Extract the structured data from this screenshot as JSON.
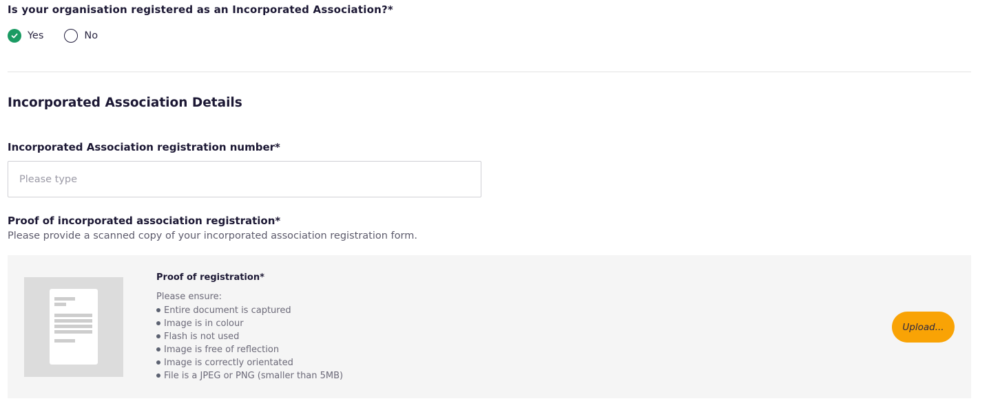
{
  "question": {
    "label": "Is your organisation registered as an Incorporated Association?*",
    "options": [
      {
        "label": "Yes",
        "selected": true
      },
      {
        "label": "No",
        "selected": false
      }
    ]
  },
  "section": {
    "title": "Incorporated Association Details"
  },
  "registration_number": {
    "label": "Incorporated Association registration number*",
    "placeholder": "Please type",
    "value": ""
  },
  "proof": {
    "label": "Proof of incorporated association registration*",
    "description": "Please provide a scanned copy of your incorporated association registration form.",
    "upload": {
      "title": "Proof of registration*",
      "ensure_title": "Please ensure:",
      "requirements": [
        "Entire document is captured",
        "Image is in colour",
        "Flash is not used",
        "Image is free of reflection",
        "Image is correctly orientated",
        "File is a JPEG or PNG (smaller than 5MB)"
      ],
      "button_label": "Upload..."
    }
  },
  "icons": {
    "selected_radio": "check-icon",
    "thumbnail": "document-icon"
  },
  "colors": {
    "selected_radio": "#1a9b63",
    "upload_button": "#f9a305",
    "panel_background": "#f5f5f5"
  }
}
